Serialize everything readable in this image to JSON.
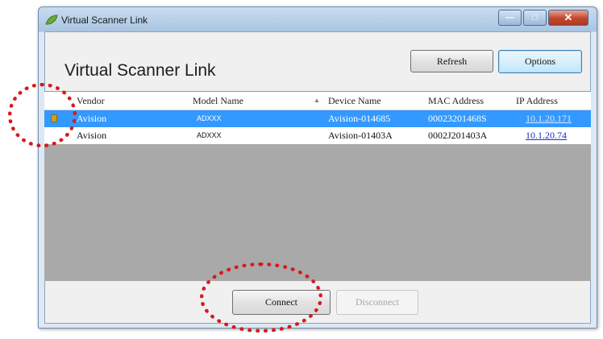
{
  "window": {
    "title": "Virtual Scanner Link",
    "controls": {
      "minimize": "—",
      "maximize": "□",
      "close": "✕"
    }
  },
  "header": {
    "title": "Virtual Scanner Link",
    "refresh_label": "Refresh",
    "options_label": "Options"
  },
  "table": {
    "columns": [
      "Vendor",
      "Model Name",
      "Device Name",
      "MAC Address",
      "IP Address"
    ],
    "sorted_column": "Device Name",
    "rows": [
      {
        "vendor": "Avision",
        "model": "ADXXX",
        "device": "Avision-014685",
        "mac": "00023201468S",
        "ip": "10.1.20.171",
        "selected": true
      },
      {
        "vendor": "Avision",
        "model": "ADXXX",
        "device": "Avision-01403A",
        "mac": "0002J201403A",
        "ip": "10.1.20.74",
        "selected": false
      }
    ]
  },
  "footer": {
    "connect_label": "Connect",
    "disconnect_label": "Disconnect"
  },
  "colors": {
    "selection": "#3399ff",
    "annotation": "#d7191c",
    "link": "#1d2ec0"
  }
}
